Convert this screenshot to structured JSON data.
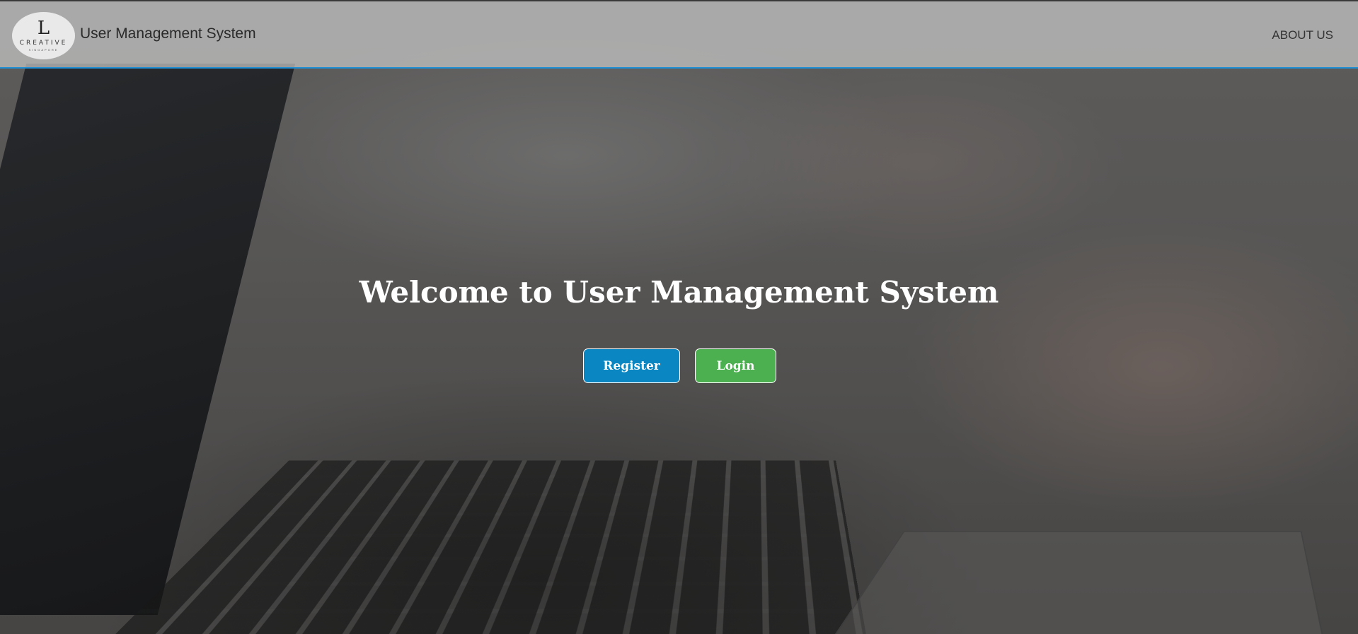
{
  "navbar": {
    "logo": {
      "mark": "L",
      "text": "CREATIVE",
      "subtext": "SINGAPORE"
    },
    "brand_title": "User Management System",
    "links": [
      {
        "label": "ABOUT US"
      }
    ]
  },
  "hero": {
    "title": "Welcome to User Management System",
    "buttons": {
      "register_label": "Register",
      "login_label": "Login"
    }
  },
  "colors": {
    "navbar_border": "#1e8fd4",
    "register_button": "#0a87c2",
    "login_button": "#4caf50",
    "title_text": "#ffffff"
  }
}
